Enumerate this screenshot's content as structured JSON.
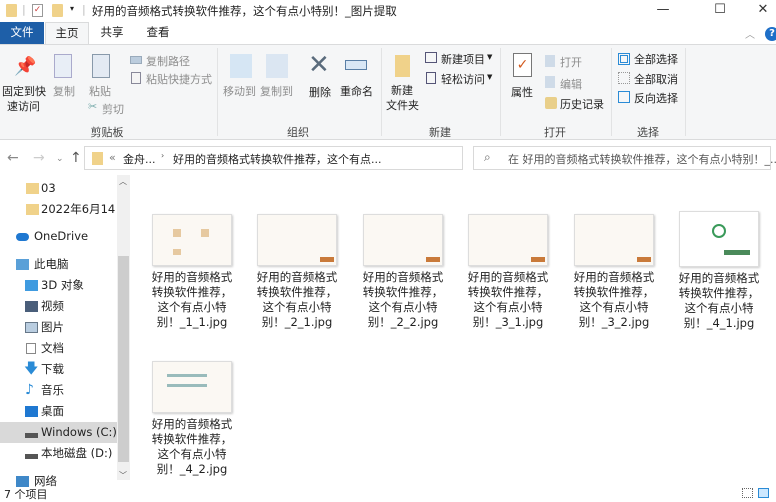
{
  "window": {
    "title": "好用的音频格式转换软件推荐，这个有点小特别！_图片提取",
    "minimize": "—",
    "maximize": "☐",
    "close": "✕"
  },
  "tabs": {
    "file": "文件",
    "home": "主页",
    "share": "共享",
    "view": "查看"
  },
  "ribbon": {
    "clipboard": {
      "label": "剪贴板",
      "pin": "固定到快\n速访问",
      "pin1": "固定到快",
      "pin2": "速访问",
      "copy": "复制",
      "paste": "粘贴",
      "copy_path": "复制路径",
      "paste_shortcut": "粘贴快捷方式",
      "cut": "剪切"
    },
    "organize": {
      "label": "组织",
      "move_to": "移动到",
      "copy_to": "复制到",
      "delete": "删除",
      "rename": "重命名"
    },
    "new": {
      "label": "新建",
      "new_folder1": "新建",
      "new_folder2": "文件夹",
      "new_item": "新建项目",
      "easy_access": "轻松访问"
    },
    "open": {
      "label": "打开",
      "properties": "属性",
      "open": "打开",
      "edit": "编辑",
      "history": "历史记录"
    },
    "select": {
      "label": "选择",
      "select_all": "全部选择",
      "select_none": "全部取消",
      "invert": "反向选择"
    }
  },
  "address": {
    "prefix": "«",
    "crumb1": "金舟...",
    "crumb2": "好用的音频格式转换软件推荐，这个有点...",
    "search_placeholder": "在 好用的音频格式转换软件推荐，这个有点小特别！_..."
  },
  "nav": [
    {
      "label": "03",
      "icon": "folder-icon"
    },
    {
      "label": "2022年6月14日",
      "icon": "folder-icon"
    },
    {
      "label": "OneDrive",
      "icon": "cloud-icon"
    },
    {
      "label": "此电脑",
      "icon": "computer-icon"
    },
    {
      "label": "3D 对象",
      "icon": "cube-icon"
    },
    {
      "label": "视频",
      "icon": "video-icon"
    },
    {
      "label": "图片",
      "icon": "picture-icon"
    },
    {
      "label": "文档",
      "icon": "document-icon"
    },
    {
      "label": "下载",
      "icon": "download-icon"
    },
    {
      "label": "音乐",
      "icon": "music-icon"
    },
    {
      "label": "桌面",
      "icon": "desktop-icon"
    },
    {
      "label": "Windows (C:)",
      "icon": "drive-icon"
    },
    {
      "label": "本地磁盘 (D:)",
      "icon": "drive-icon"
    },
    {
      "label": "网络",
      "icon": "network-icon"
    }
  ],
  "files": [
    {
      "name": "好用的音频格式转换软件推荐，这个有点小特别！_1_1.jpg"
    },
    {
      "name": "好用的音频格式转换软件推荐，这个有点小特别！_2_1.jpg"
    },
    {
      "name": "好用的音频格式转换软件推荐，这个有点小特别！_2_2.jpg"
    },
    {
      "name": "好用的音频格式转换软件推荐，这个有点小特别！_3_1.jpg"
    },
    {
      "name": "好用的音频格式转换软件推荐，这个有点小特别！_3_2.jpg"
    },
    {
      "name": "好用的音频格式转换软件推荐，这个有点小特别！_4_1.jpg"
    },
    {
      "name": "好用的音频格式转换软件推荐，这个有点小特别！_4_2.jpg"
    }
  ],
  "status": {
    "count": "7 个项目"
  },
  "colors": {
    "accent": "#1e5fa8",
    "folder": "#f0d28a"
  }
}
